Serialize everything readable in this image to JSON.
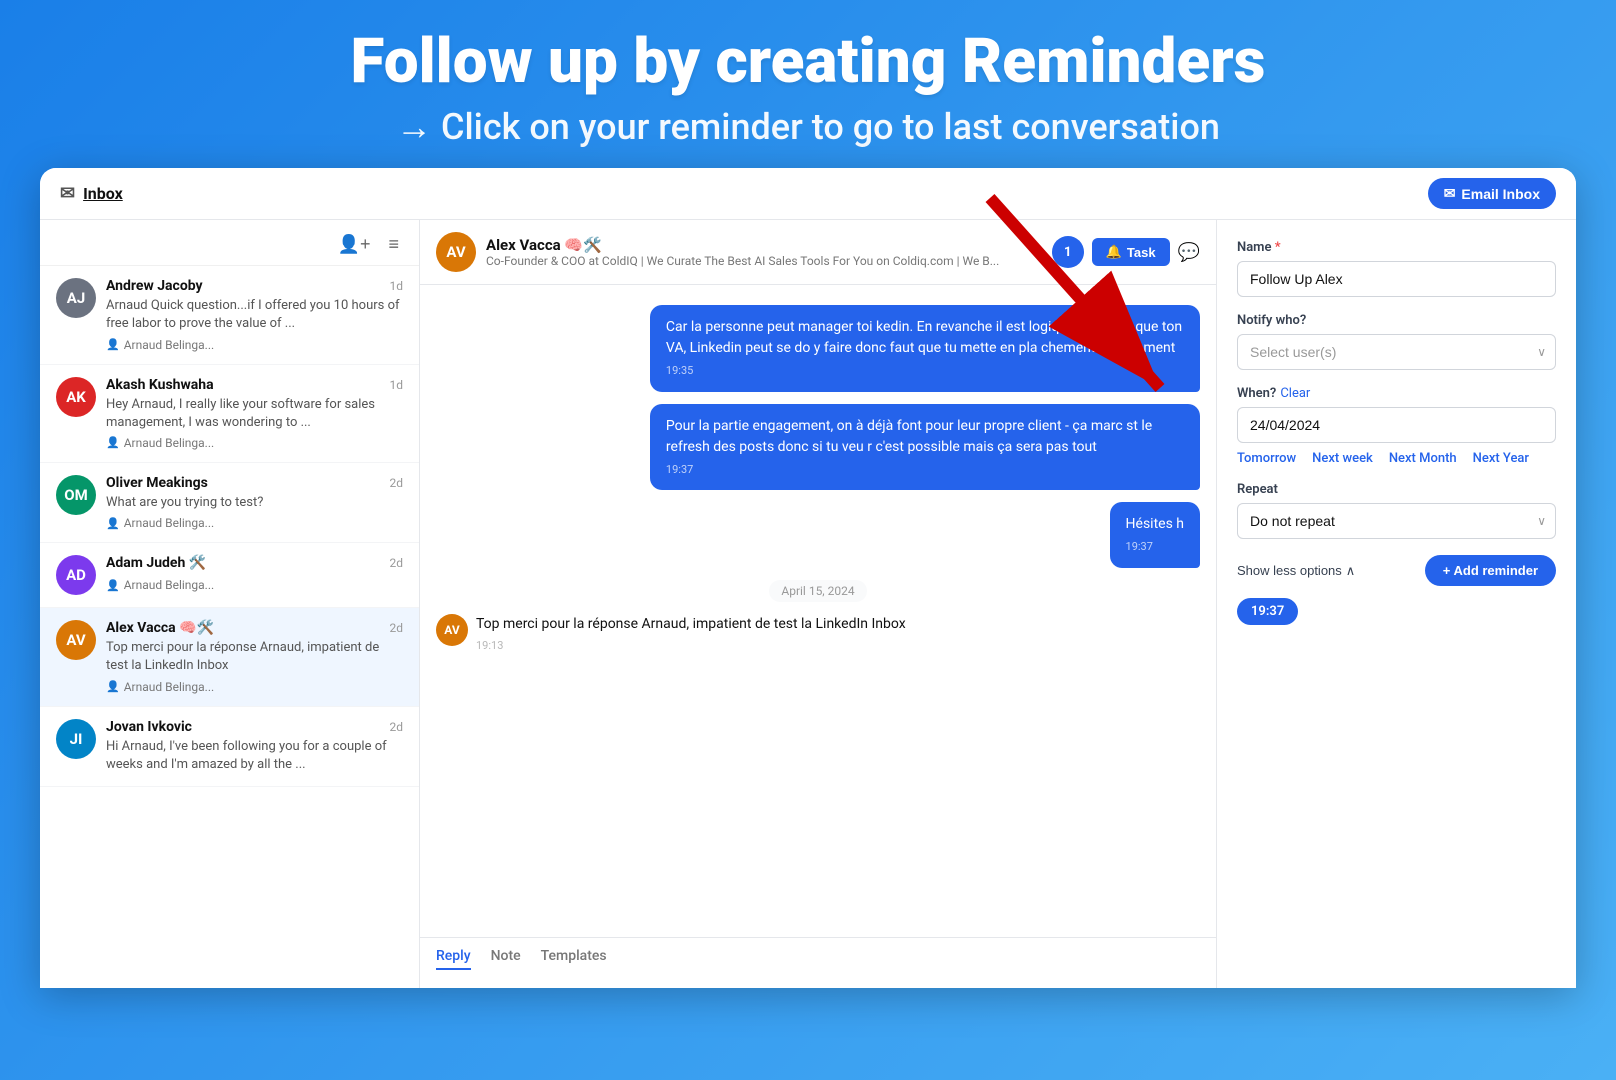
{
  "hero": {
    "title": "Follow up by creating Reminders",
    "subtitle": "→ Click on your reminder to go to last conversation"
  },
  "topbar": {
    "inbox_label": "Inbox",
    "email_inbox_label": "Email Inbox"
  },
  "sidebar": {
    "conversations": [
      {
        "id": "andrew",
        "name": "Andrew Jacoby",
        "time": "1d",
        "preview": "Arnaud Quick question...if I offered you 10 hours of free labor to prove the value of ...",
        "agent": "Arnaud Belinga...",
        "avatar_color": "av-andrew",
        "avatar_initial": "AJ"
      },
      {
        "id": "akash",
        "name": "Akash Kushwaha",
        "time": "1d",
        "preview": "Hey Arnaud, I really like your software for sales management, I was wondering to ...",
        "agent": "Arnaud Belinga...",
        "avatar_color": "av-akash",
        "avatar_initial": "AK"
      },
      {
        "id": "oliver",
        "name": "Oliver Meakings",
        "time": "2d",
        "preview": "What are you trying to test?",
        "agent": "Arnaud Belinga...",
        "avatar_color": "av-oliver",
        "avatar_initial": "OM"
      },
      {
        "id": "adam",
        "name": "Adam Judeh 🛠️",
        "time": "2d",
        "preview": "",
        "agent": "Arnaud Belinga...",
        "avatar_color": "av-adam",
        "avatar_initial": "AD"
      },
      {
        "id": "alex",
        "name": "Alex Vacca 🧠🛠️",
        "time": "2d",
        "preview": "Top merci pour la réponse Arnaud, impatient de test la LinkedIn Inbox",
        "agent": "Arnaud Belinga...",
        "avatar_color": "av-alex",
        "avatar_initial": "AV",
        "active": true
      },
      {
        "id": "jovan",
        "name": "Jovan Ivkovic",
        "time": "2d",
        "preview": "Hi Arnaud, I've been following you for a couple of weeks and I'm amazed by all the ...",
        "agent": "",
        "avatar_color": "av-jovan",
        "avatar_initial": "JI"
      }
    ]
  },
  "chat": {
    "contact_name": "Alex Vacca 🧠🛠️",
    "contact_sub": "Co-Founder & COO at ColdIQ | We Curate The Best AI Sales Tools For You on Coldiq.com | We B...",
    "messages": [
      {
        "type": "sent",
        "text": "Car la personne peut manager toi kedin. En revanche il est logique que mps que ton VA, Linkedin peut se do y faire donc faut que tu mette en pla chements idéalement",
        "time": "19:35"
      },
      {
        "type": "sent",
        "text": "Pour la partie engagement, on à déjà font pour leur propre client - ça marc st le refresh des posts donc si tu veu r c'est possible mais ça sera pas tout",
        "time": "19:37"
      },
      {
        "type": "sent",
        "text": "Hésites h",
        "time": "19:37"
      },
      {
        "type": "date_sep",
        "text": "April 15, 2024"
      },
      {
        "type": "received",
        "text": "Top merci pour la réponse Arnaud, impatient de test la LinkedIn Inbox",
        "time": "19:13"
      }
    ],
    "compose_tabs": [
      "Reply",
      "Note",
      "Templates"
    ],
    "active_tab": "Reply"
  },
  "task_panel": {
    "name_label": "Name",
    "name_value": "Follow Up Alex",
    "notify_label": "Notify who?",
    "notify_placeholder": "Select user(s)",
    "when_label": "When?",
    "clear_label": "Clear",
    "date_value": "24/04/2024",
    "quick_dates": [
      "Tomorrow",
      "Next week",
      "Next Month",
      "Next Year"
    ],
    "repeat_label": "Repeat",
    "repeat_value": "Do not repeat",
    "show_less_label": "Show less options",
    "add_reminder_label": "+ Add reminder",
    "last_msg_time": "19:37"
  },
  "icons": {
    "inbox": "✉",
    "task": "🔔",
    "filter": "≡",
    "people": "👥",
    "chat_bubble": "💬",
    "chevron_down": "∨",
    "chevron_up": "∧"
  }
}
